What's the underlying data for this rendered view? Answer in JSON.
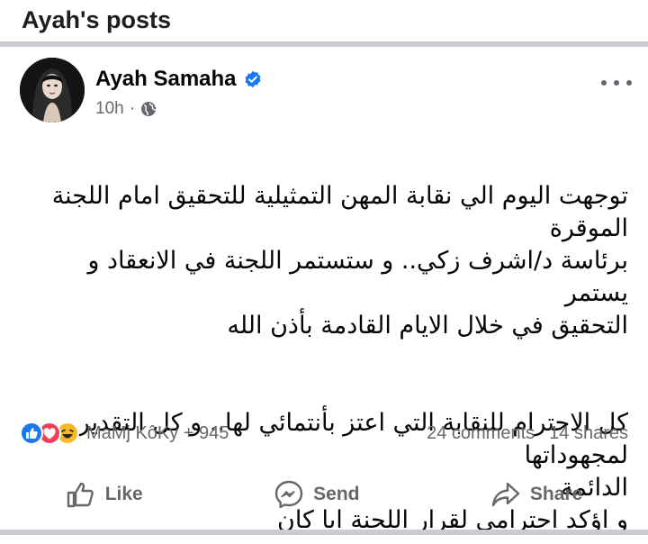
{
  "page": {
    "title": "Ayah's posts"
  },
  "post": {
    "author": "Ayah Samaha",
    "time": "10h",
    "separator": "·",
    "body_lines": [
      "توجهت اليوم الي نقابة المهن التمثيلية للتحقيق امام اللجنة الموقرة",
      "برئاسة د/اشرف زكي.. و ستستمر اللجنة في الانعقاد و يستمر",
      "التحقيق في خلال الايام القادمة بأذن الله"
    ],
    "body_lines_2": [
      "كل الاحترام للنقابة التي اعتز بأنتمائي لها.. و كل التقدير لمجهوداتها",
      "الدائمة",
      "و اؤكد احترامي لقرار اللجنة ايا كان"
    ]
  },
  "stats": {
    "reaction_names": "MaMj KôKy + 945",
    "comments": "24 comments",
    "shares": "14 shares"
  },
  "actions": {
    "like": "Like",
    "send": "Send",
    "share": "Share"
  },
  "icons": [
    "verified-badge-icon",
    "globe-icon",
    "more-icon",
    "like-reaction-icon",
    "love-reaction-icon",
    "haha-reaction-icon",
    "thumbs-up-icon",
    "messenger-icon",
    "share-icon"
  ],
  "colors": {
    "brand": "#1877f2",
    "secondary_text": "#65676b",
    "divider": "#c9ccd1"
  }
}
